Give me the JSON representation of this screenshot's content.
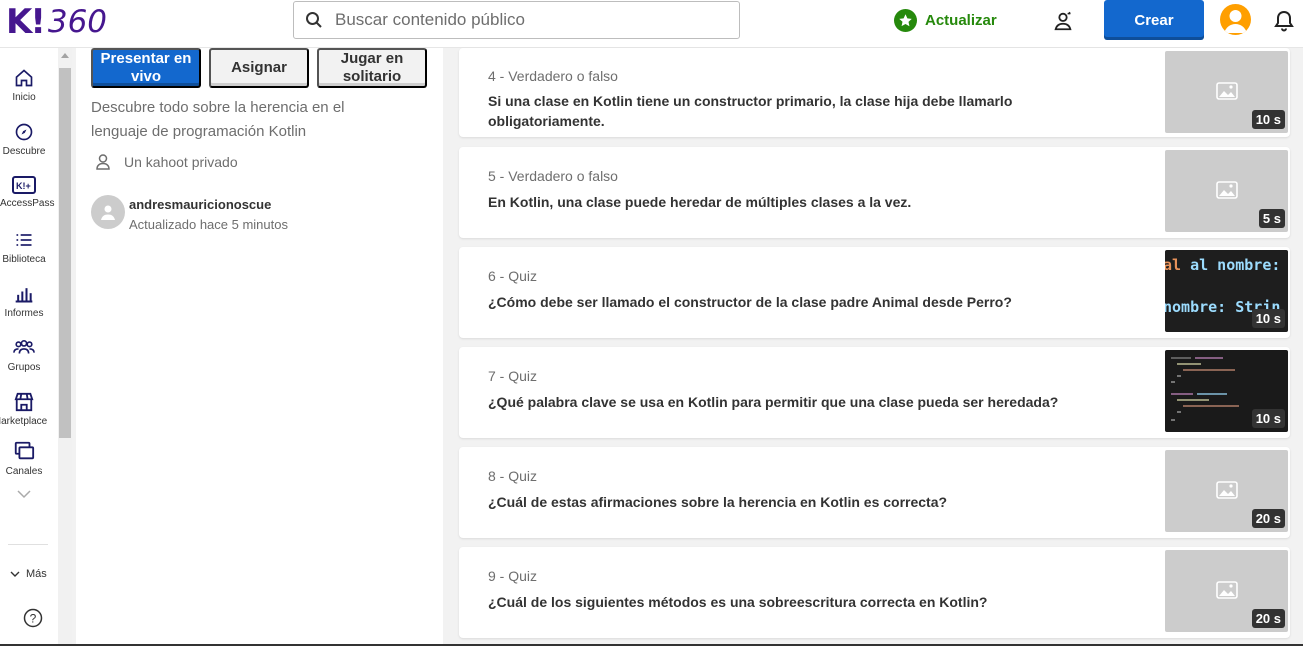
{
  "header": {
    "logo_k": "K!",
    "logo_num": "360",
    "search_placeholder": "Buscar contenido público",
    "upgrade_label": "Actualizar",
    "create_label": "Crear"
  },
  "nav": {
    "items": [
      {
        "label": "Inicio",
        "icon": "home-icon"
      },
      {
        "label": "Descubre",
        "icon": "compass-icon"
      },
      {
        "label": "AccessPass",
        "icon": "accesspass-icon"
      },
      {
        "label": "Biblioteca",
        "icon": "list-icon"
      },
      {
        "label": "Informes",
        "icon": "chart-icon"
      },
      {
        "label": "Grupos",
        "icon": "group-icon"
      },
      {
        "label": "Marketplace",
        "icon": "store-icon"
      },
      {
        "label": "Canales",
        "icon": "channels-icon"
      }
    ],
    "more_label": "Más"
  },
  "info": {
    "present_label": "Presentar en vivo",
    "assign_label": "Asignar",
    "solo_label": "Jugar en solitario",
    "description": "Descubre todo sobre la herencia en el lenguaje de programación Kotlin",
    "privacy": "Un kahoot privado",
    "author": "andresmauricionoscue",
    "updated": "Actualizado hace 5 minutos"
  },
  "questions": [
    {
      "meta": "4 - Verdadero o falso",
      "text": "Si una clase en Kotlin tiene un constructor primario, la clase hija debe llamarlo obligatoriamente.",
      "time": "10 s",
      "image": "placeholder"
    },
    {
      "meta": "5 - Verdadero o falso",
      "text": "En Kotlin, una clase puede heredar de múltiples clases a la vez.",
      "time": "5 s",
      "image": "placeholder"
    },
    {
      "meta": "6 - Quiz",
      "text": "¿Cómo debe ser llamado el constructor de la clase padre Animal desde Perro?",
      "time": "10 s",
      "image": "code",
      "code_lines": [
        "al nombre: Str",
        "nombre: Strin"
      ]
    },
    {
      "meta": "7 - Quiz",
      "text": "¿Qué palabra clave se usa en Kotlin para permitir que una clase pueda ser heredada?",
      "time": "10 s",
      "image": "code-small"
    },
    {
      "meta": "8 - Quiz",
      "text": "¿Cuál de estas afirmaciones sobre la herencia en Kotlin es correcta?",
      "time": "20 s",
      "image": "placeholder"
    },
    {
      "meta": "9 - Quiz",
      "text": "¿Cuál de los siguientes métodos es una sobreescritura correcta en Kotlin?",
      "time": "20 s",
      "image": "placeholder"
    }
  ],
  "colors": {
    "brand": "#46178f",
    "primary": "#1368ce",
    "green": "#26890c",
    "avatar": "#ff9f00"
  }
}
